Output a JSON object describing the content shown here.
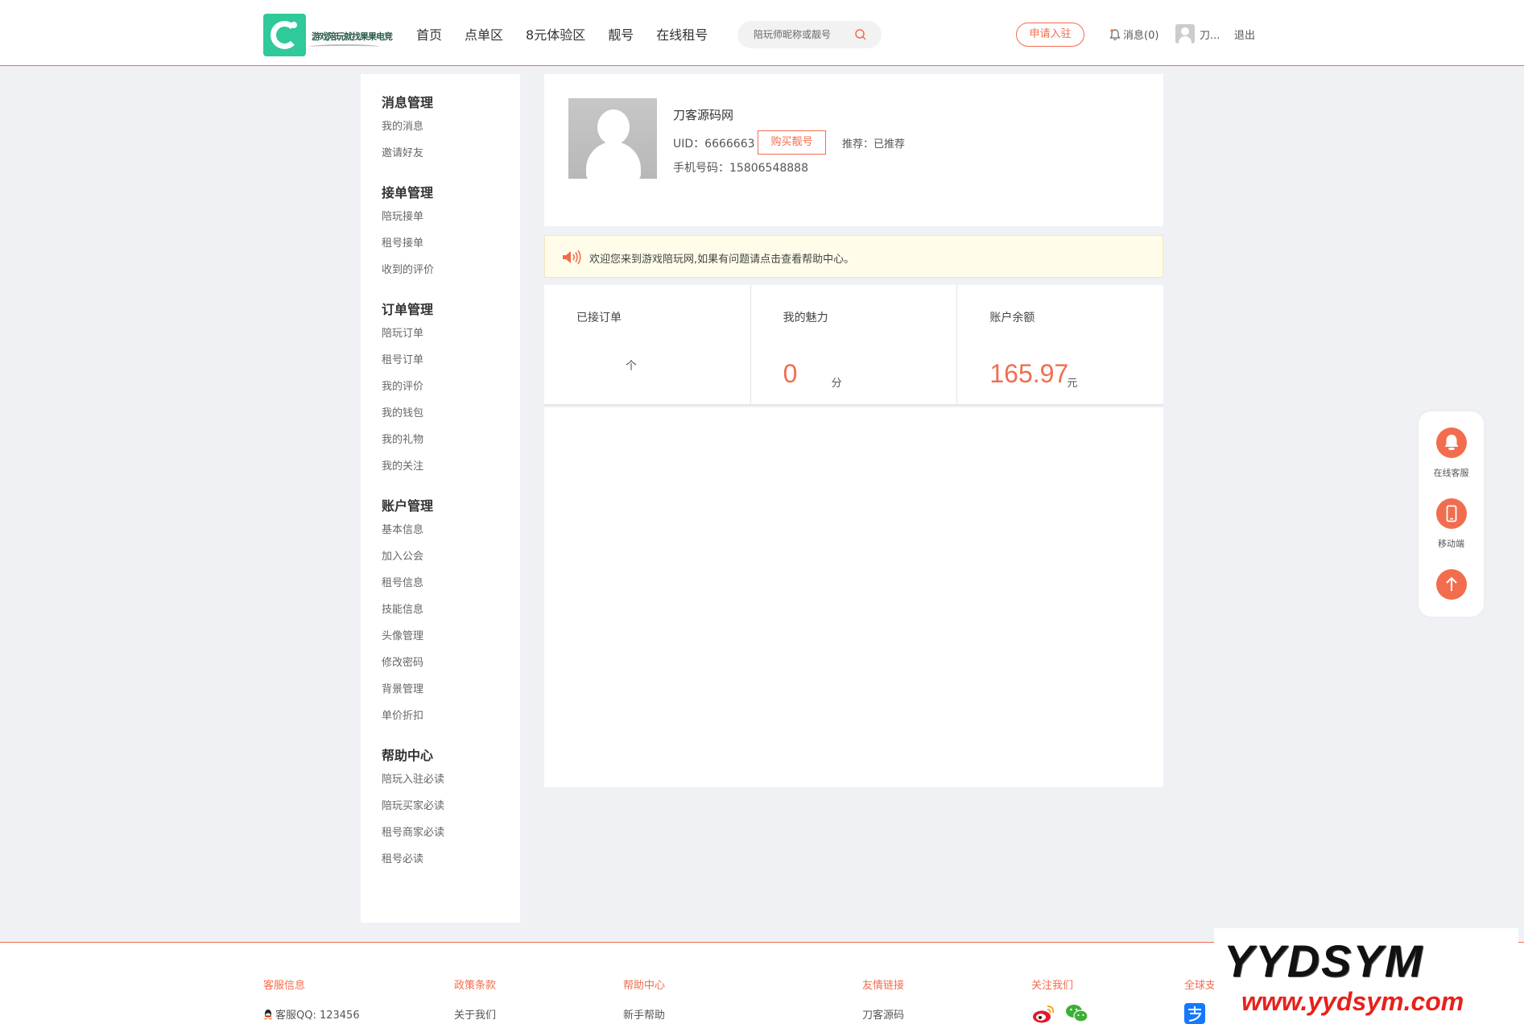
{
  "header": {
    "logo_text": "游戏陪玩就找果果电竞",
    "nav": [
      "首页",
      "点单区",
      "8元体验区",
      "靓号",
      "在线租号"
    ],
    "search_placeholder": "陪玩师昵称或靓号",
    "apply_label": "申请入驻",
    "messages_label": "消息(0)",
    "username": "刀...",
    "logout_label": "退出"
  },
  "sidebar": {
    "groups": [
      {
        "title": "消息管理",
        "items": [
          "我的消息",
          "邀请好友"
        ]
      },
      {
        "title": "接单管理",
        "items": [
          "陪玩接单",
          "租号接单",
          "收到的评价"
        ]
      },
      {
        "title": "订单管理",
        "items": [
          "陪玩订单",
          "租号订单",
          "我的评价",
          "我的钱包",
          "我的礼物",
          "我的关注"
        ]
      },
      {
        "title": "账户管理",
        "items": [
          "基本信息",
          "加入公会",
          "租号信息",
          "技能信息",
          "头像管理",
          "修改密码",
          "背景管理",
          "单价折扣"
        ]
      },
      {
        "title": "帮助中心",
        "items": [
          "陪玩入驻必读",
          "陪玩买家必读",
          "租号商家必读",
          "租号必读"
        ]
      }
    ]
  },
  "profile": {
    "name": "刀客源码网",
    "uid": "UID：6666663",
    "buy_label": "购买靓号",
    "recommend": "推荐：已推荐",
    "phone": "手机号码：15806548888"
  },
  "notice": {
    "text": "欢迎您来到游戏陪玩网,如果有问题请点击查看帮助中心。"
  },
  "stats": {
    "orders_label": "已接订单",
    "orders_value": "个",
    "charm_label": "我的魅力",
    "charm_value": "0",
    "charm_unit": "分",
    "balance_label": "账户余额",
    "balance_value": "165.97",
    "balance_unit": "元"
  },
  "float_bar": {
    "service_label": "在线客服",
    "mobile_label": "移动端"
  },
  "footer": {
    "cols": [
      {
        "title": "客服信息",
        "item": "客服QQ: 123456"
      },
      {
        "title": "政策条款",
        "item": "关于我们"
      },
      {
        "title": "帮助中心",
        "item": "新手帮助"
      },
      {
        "title": "友情链接",
        "item": "刀客源码"
      },
      {
        "title": "关注我们"
      },
      {
        "title": "全球支"
      }
    ]
  },
  "watermark": {
    "top": "YYDSYM",
    "bottom": "www.yydsym.com"
  },
  "colors": {
    "accent": "#f26d4e",
    "logo_green": "#2fc99b",
    "page_bg": "#f0f1f5",
    "notice_bg": "#fffdea"
  }
}
